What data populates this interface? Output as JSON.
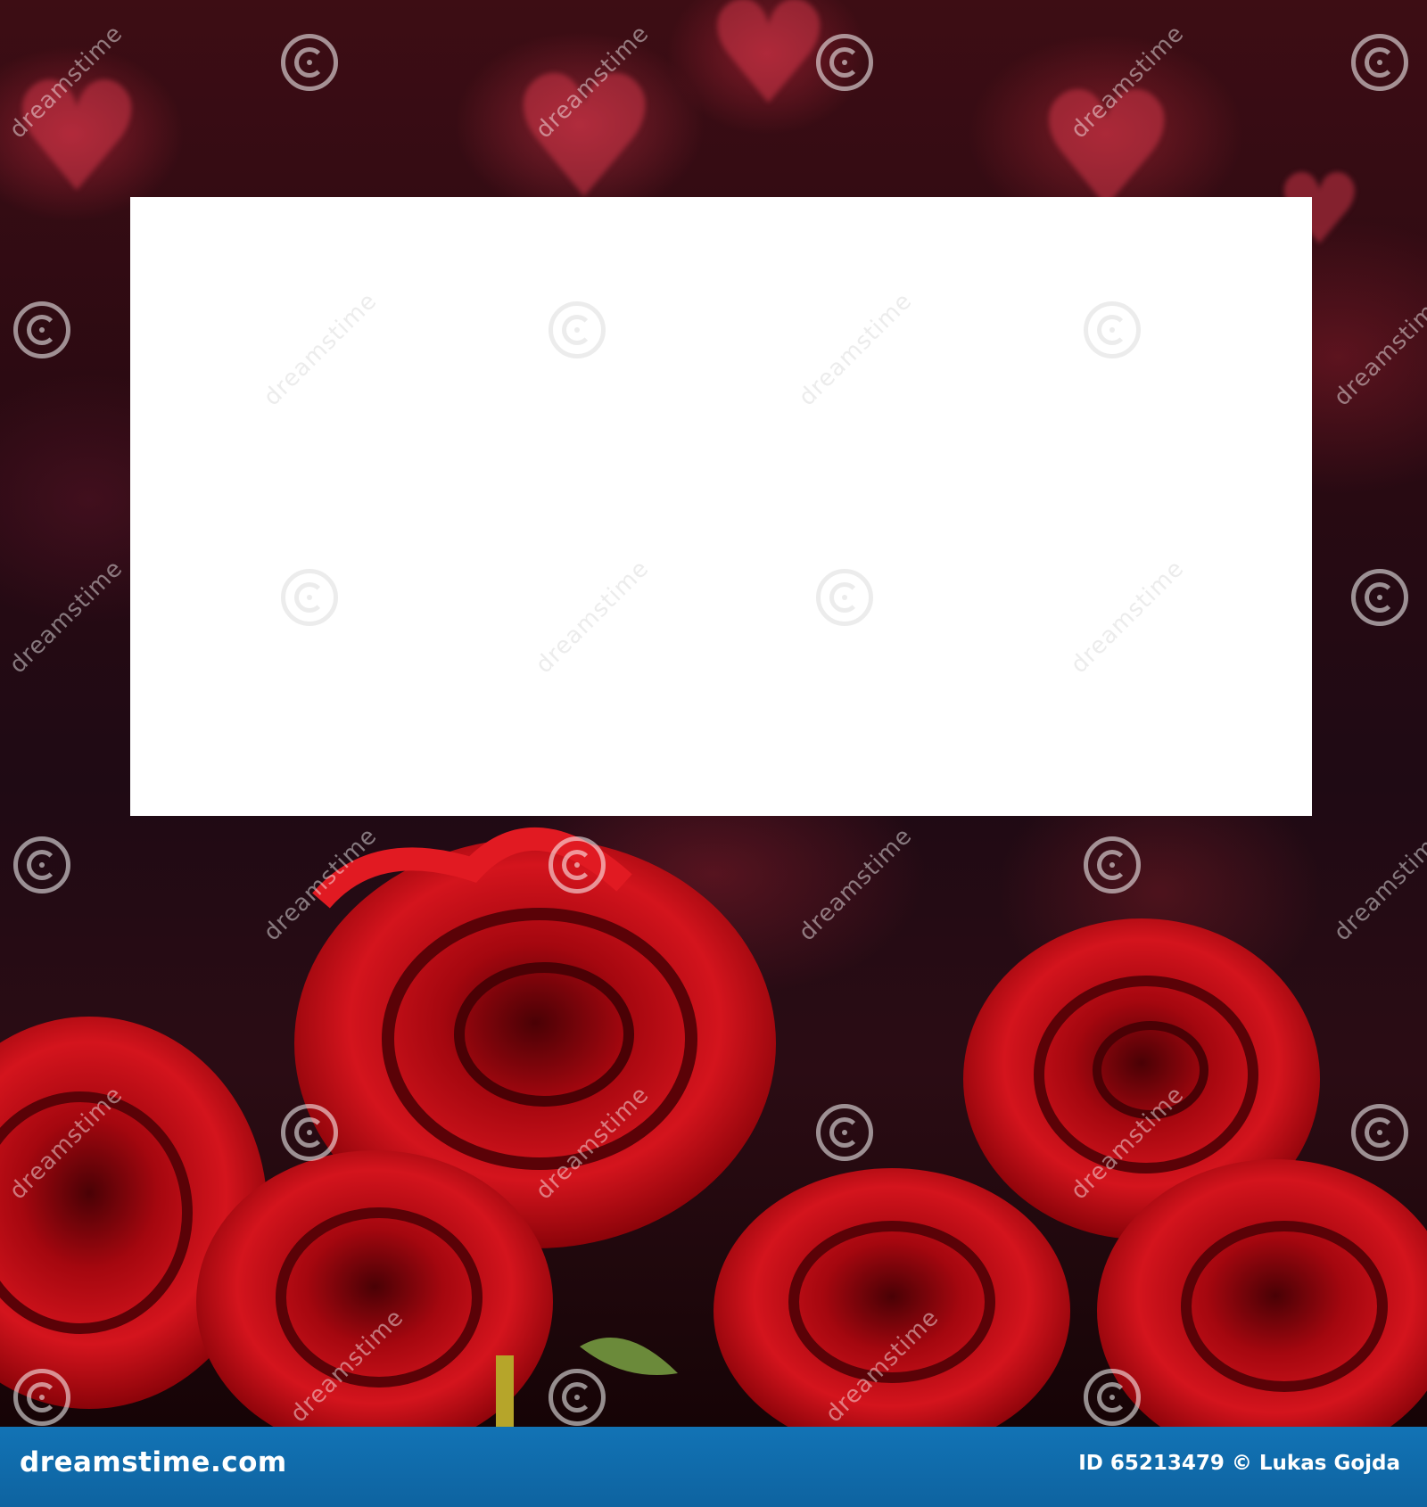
{
  "photo": {
    "watermark_text": "dreamstime",
    "footer": {
      "logo": "dreamstime.com",
      "credit": "ID 65213479 © Lukas Gojda"
    },
    "colors": {
      "rose_red": "#c8101a",
      "rose_shadow": "#6a0208",
      "card": "#ffffff",
      "footer_blue": "#1273b5"
    }
  }
}
